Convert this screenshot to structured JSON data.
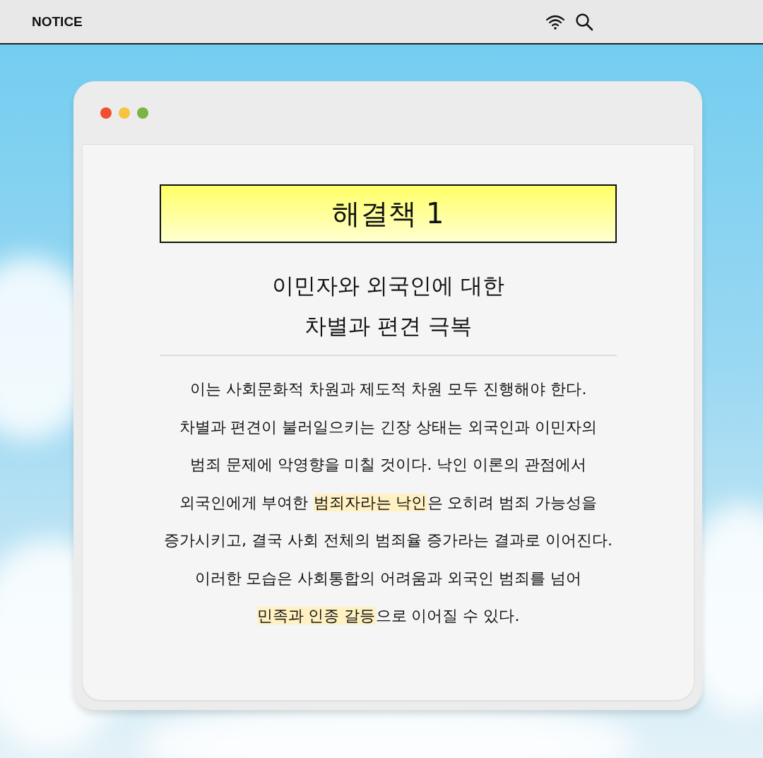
{
  "menu_bar": {
    "title": "NOTICE"
  },
  "window": {
    "controls": [
      {
        "color": "#f0502e"
      },
      {
        "color": "#f7c440"
      },
      {
        "color": "#7cb342"
      }
    ],
    "heading": "해결책 1",
    "subtitle_lines": [
      "이민자와 외국인에 대한",
      "차별과 편견 극복"
    ],
    "body_lines": [
      [
        {
          "text": "이는 사회문화적 차원과 제도적 차원 모두 진행해야 한다.",
          "highlighted": false
        }
      ],
      [
        {
          "text": "차별과 편견이 불러일으키는 긴장 상태는 외국인과 이민자의",
          "highlighted": false
        }
      ],
      [
        {
          "text": "범죄 문제에 악영향을 미칠 것이다. 낙인 이론의 관점에서",
          "highlighted": false
        }
      ],
      [
        {
          "text": "외국인에게 부여한 ",
          "highlighted": false
        },
        {
          "text": "범죄자라는 낙인",
          "highlighted": true
        },
        {
          "text": "은 오히려 범죄 가능성을",
          "highlighted": false
        }
      ],
      [
        {
          "text": "증가시키고, 결국 사회 전체의 범죄율 증가라는 결과로 이어진다.",
          "highlighted": false
        }
      ],
      [
        {
          "text": "이러한 모습은 사회통합의 어려움과 외국인 범죄를 넘어",
          "highlighted": false
        }
      ],
      [
        {
          "text": "민족과 인종 갈등",
          "highlighted": true
        },
        {
          "text": "으로 이어질 수 있다.",
          "highlighted": false
        }
      ]
    ]
  }
}
